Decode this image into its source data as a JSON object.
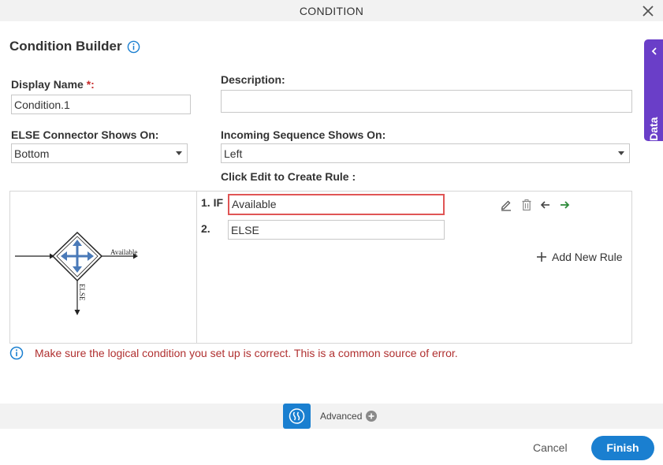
{
  "window": {
    "title": "CONDITION",
    "close_icon": "close-icon"
  },
  "heading": {
    "text": "Condition Builder",
    "info_icon": "info-circle-icon"
  },
  "form": {
    "display_name": {
      "label": "Display Name",
      "required_mark": "*:",
      "value": "Condition.1"
    },
    "description": {
      "label": "Description:",
      "value": ""
    },
    "else_connector": {
      "label": "ELSE Connector Shows On:",
      "value": "Bottom"
    },
    "incoming_sequence": {
      "label": "Incoming Sequence Shows On:",
      "value": "Left"
    },
    "rule_hint": "Click Edit to Create Rule :"
  },
  "diagram": {
    "right_label": "Available",
    "bottom_label": "ELSE"
  },
  "rules": [
    {
      "number": "1. IF",
      "text": "Available"
    },
    {
      "number": "2.",
      "text": "ELSE"
    }
  ],
  "rule_tools": [
    "edit-pencil-icon",
    "delete-trash-icon",
    "arrow-left-icon",
    "arrow-right-icon"
  ],
  "add_rule_label": "Add New Rule",
  "warning": "Make sure the logical condition you set up is correct. This is a common source of error.",
  "app_data_tab": "App Data",
  "advanced": {
    "label": "Advanced"
  },
  "footer": {
    "cancel": "Cancel",
    "finish": "Finish"
  },
  "colors": {
    "accent": "#1a7fd0",
    "app_data": "#6a3ec8",
    "warning": "#b03030",
    "active_rule_border": "#e05555"
  }
}
